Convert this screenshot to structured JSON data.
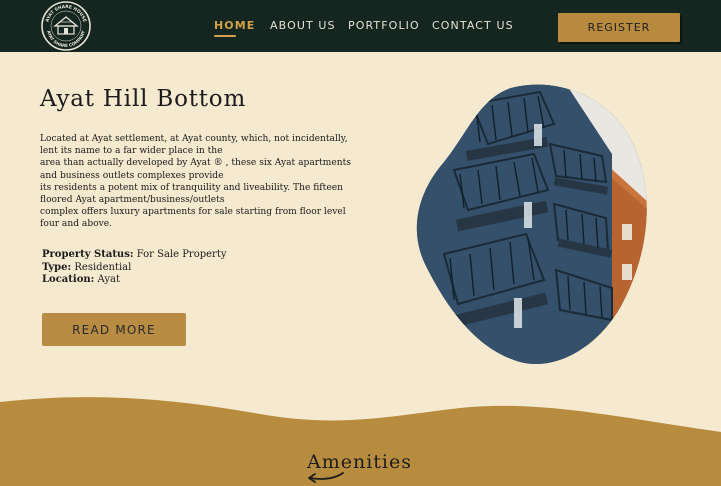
{
  "nav": {
    "logo_text_top": "AYAT SHARE HOUSE",
    "logo_text_bottom": "AYAT SHARE COMPANY",
    "links": [
      {
        "label": "HOME",
        "active": true
      },
      {
        "label": "ABOUT US",
        "active": false
      },
      {
        "label": "PORTFOLIO",
        "active": false
      },
      {
        "label": "CONTACT US",
        "active": false
      }
    ],
    "register_label": "REGISTER"
  },
  "property": {
    "title": "Ayat Hill Bottom",
    "description": "Located at Ayat settlement, at Ayat county, which, not incidentally, lent its name to a far wider place in the\n area than actually developed by Ayat ® , these six Ayat apartments and business outlets complexes provide\n its residents a potent mix of tranquility and liveability. The fifteen floored Ayat apartment/business/outlets\ncomplex offers luxury apartments for sale starting from floor level four and above.",
    "status_label": "Property Status:",
    "status_value": "For Sale Property",
    "type_label": "Type:",
    "type_value": "Residential",
    "location_label": "Location:",
    "location_value": "Ayat",
    "read_more_label": "READ MORE"
  },
  "amenities": {
    "title": "Amenities"
  },
  "colors": {
    "nav_bg": "#14261f",
    "page_bg": "#f5e9cf",
    "accent": "#b88c43",
    "active_link": "#d2a149"
  }
}
